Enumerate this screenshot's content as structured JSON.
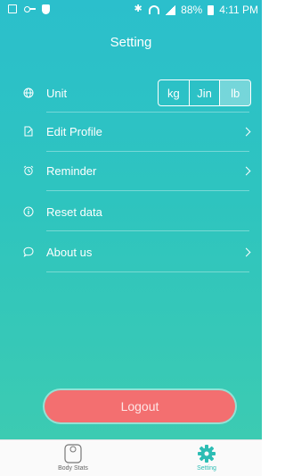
{
  "status_bar": {
    "battery": "88%",
    "time": "4:11 PM"
  },
  "header": {
    "title": "Setting"
  },
  "settings": {
    "unit": {
      "label": "Unit",
      "icon": "globe-icon",
      "options": [
        "kg",
        "Jin",
        "lb"
      ],
      "selected": "lb"
    },
    "items": [
      {
        "label": "Edit Profile",
        "icon": "edit-profile-icon",
        "has_arrow": true
      },
      {
        "label": "Reminder",
        "icon": "alarm-clock-icon",
        "has_arrow": true
      },
      {
        "label": "Reset data",
        "icon": "info-icon",
        "has_arrow": false
      },
      {
        "label": "About us",
        "icon": "chat-bubble-icon",
        "has_arrow": true
      }
    ]
  },
  "logout_label": "Logout",
  "tabbar": {
    "tabs": [
      {
        "label": "Body Stats",
        "icon": "scale-icon",
        "active": false
      },
      {
        "label": "Setting",
        "icon": "gear-icon",
        "active": true
      }
    ]
  },
  "colors": {
    "accent": "#2dbdb4",
    "logout": "#f36f70",
    "background": "#2ec4bf"
  }
}
